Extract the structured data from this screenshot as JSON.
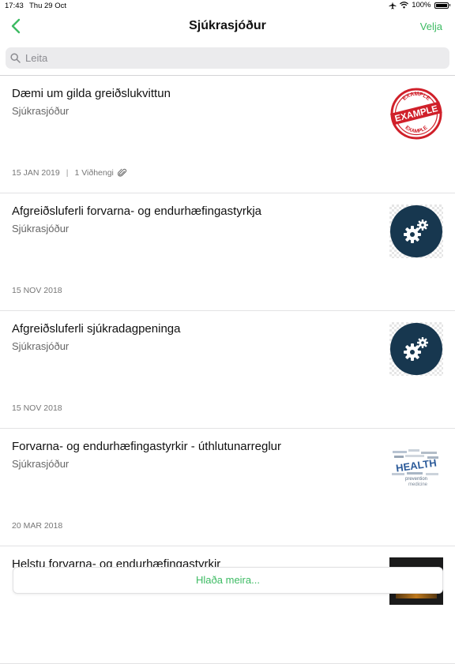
{
  "status_bar": {
    "time": "17:43",
    "date": "Thu 29 Oct",
    "battery": "100%"
  },
  "nav": {
    "title": "Sjúkrasjóður",
    "action": "Velja"
  },
  "search": {
    "placeholder": "Leita"
  },
  "items": [
    {
      "title": "Dæmi um gilda greiðslukvittun",
      "subtitle": "Sjúkrasjóður",
      "date": "15 JAN 2019",
      "attachments": "1 Viðhengi",
      "thumb_stamp": {
        "arc_top": "EXAMPLE",
        "center": "EXAMPLE",
        "arc_bottom": "EXAMPLE"
      }
    },
    {
      "title": "Afgreiðsluferli forvarna- og endurhæfingastyrkja",
      "subtitle": "Sjúkrasjóður",
      "date": "15 NOV 2018"
    },
    {
      "title": "Afgreiðsluferli sjúkradagpeninga",
      "subtitle": "Sjúkrasjóður",
      "date": "15 NOV 2018"
    },
    {
      "title": "Forvarna- og endurhæfingastyrkir - úthlutunarreglur",
      "subtitle": "Sjúkrasjóður",
      "date": "20 MAR 2018",
      "thumb_words": {
        "main": "HEALTH",
        "line2": "prevention",
        "line3": "medicine"
      }
    },
    {
      "title": "Helstu forvarna- og endurhæfingastyrkir"
    }
  ],
  "load_more": "Hlaða meira...",
  "colors": {
    "accent": "#3dbb63",
    "gear_bg": "#17374f",
    "stamp": "#d0202a"
  }
}
